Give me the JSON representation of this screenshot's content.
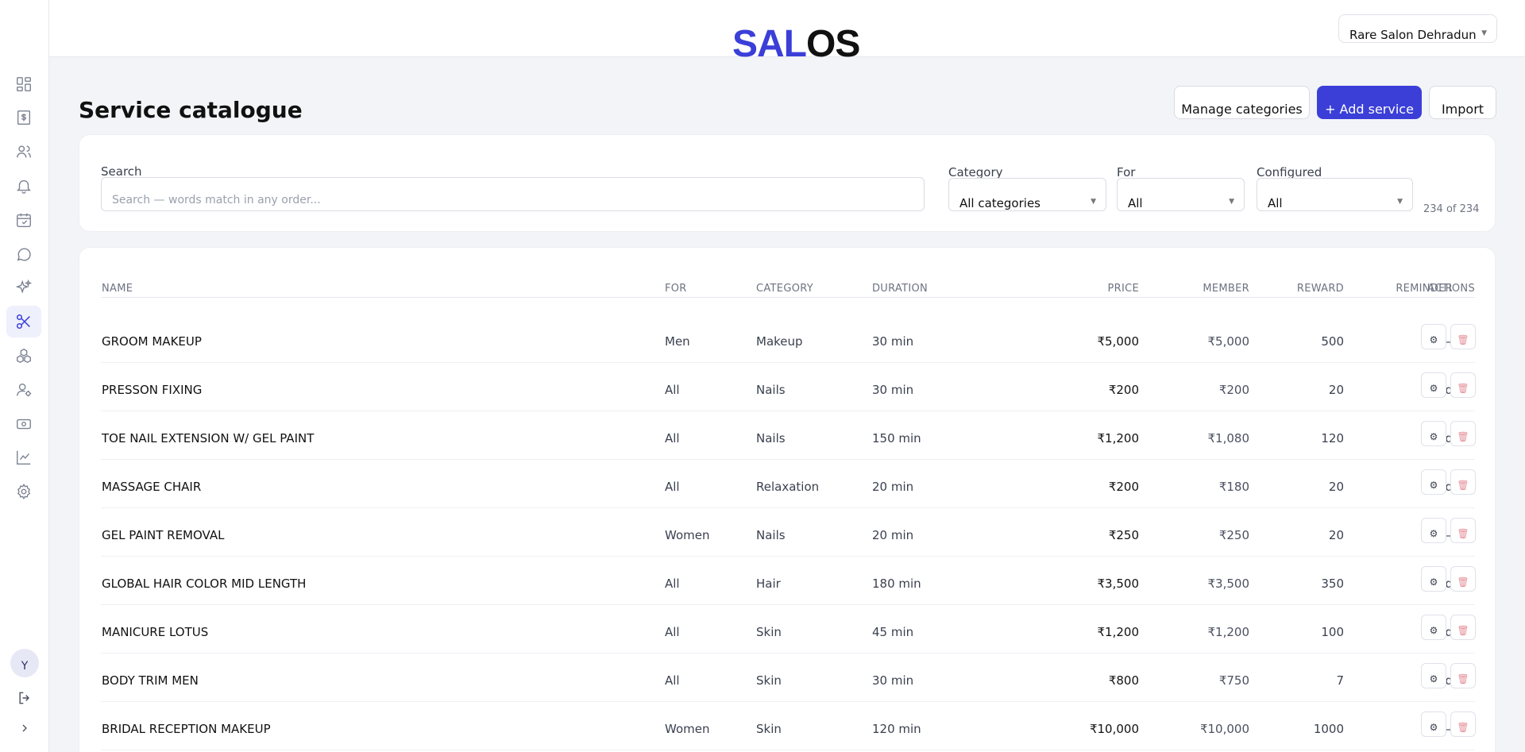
{
  "header": {
    "logo_part1": "SAL",
    "logo_part2": "OS",
    "salon_selected": "Rare Salon Dehradun"
  },
  "page": {
    "title": "Service catalogue",
    "buttons": {
      "manage_categories": "Manage categories",
      "add_service": "+ Add service",
      "import": "Import"
    }
  },
  "filters": {
    "search_label": "Search",
    "search_placeholder": "Search — words match in any order...",
    "category_label": "Category",
    "category_value": "All categories",
    "for_label": "For",
    "for_value": "All",
    "configured_label": "Configured",
    "configured_value": "All",
    "count": "234 of 234"
  },
  "table": {
    "columns": [
      "NAME",
      "FOR",
      "CATEGORY",
      "DURATION",
      "PRICE",
      "MEMBER",
      "REWARD",
      "REMINDER",
      "ACTIONS"
    ],
    "rows": [
      {
        "name": "GROOM MAKEUP",
        "for": "Men",
        "category": "Makeup",
        "duration": "30 min",
        "price": "₹5,000",
        "member": "₹5,000",
        "reward": "500",
        "reminder": "—"
      },
      {
        "name": "PRESSON FIXING",
        "for": "All",
        "category": "Nails",
        "duration": "30 min",
        "price": "₹200",
        "member": "₹200",
        "reward": "20",
        "reminder": "21d"
      },
      {
        "name": "TOE NAIL EXTENSION W/ GEL PAINT",
        "for": "All",
        "category": "Nails",
        "duration": "150 min",
        "price": "₹1,200",
        "member": "₹1,080",
        "reward": "120",
        "reminder": "21d"
      },
      {
        "name": "MASSAGE CHAIR",
        "for": "All",
        "category": "Relaxation",
        "duration": "20 min",
        "price": "₹200",
        "member": "₹180",
        "reward": "20",
        "reminder": "30d"
      },
      {
        "name": "GEL PAINT REMOVAL",
        "for": "Women",
        "category": "Nails",
        "duration": "20 min",
        "price": "₹250",
        "member": "₹250",
        "reward": "20",
        "reminder": "—"
      },
      {
        "name": "GLOBAL HAIR COLOR MID LENGTH",
        "for": "All",
        "category": "Hair",
        "duration": "180 min",
        "price": "₹3,500",
        "member": "₹3,500",
        "reward": "350",
        "reminder": "42d"
      },
      {
        "name": "MANICURE LOTUS",
        "for": "All",
        "category": "Skin",
        "duration": "45 min",
        "price": "₹1,200",
        "member": "₹1,200",
        "reward": "100",
        "reminder": "21d"
      },
      {
        "name": "BODY TRIM MEN",
        "for": "All",
        "category": "Skin",
        "duration": "30 min",
        "price": "₹800",
        "member": "₹750",
        "reward": "7",
        "reminder": "30d"
      },
      {
        "name": "BRIDAL RECEPTION MAKEUP",
        "for": "Women",
        "category": "Skin",
        "duration": "120 min",
        "price": "₹10,000",
        "member": "₹10,000",
        "reward": "1000",
        "reminder": "—"
      }
    ],
    "action_icons": {
      "edit": "⚙",
      "delete": "🗑"
    }
  },
  "sidebar": {
    "items": [
      "dashboard-icon",
      "billing-icon",
      "clients-icon",
      "notifications-icon",
      "appointments-icon",
      "chat-icon",
      "ai-sparkle-icon",
      "services-scissors-icon",
      "products-icon",
      "staff-icon",
      "payments-icon",
      "reports-icon",
      "settings-icon"
    ],
    "active": "services-scissors-icon",
    "avatar_initial": "Y"
  },
  "colors": {
    "accent": "#3b3fd8",
    "delete": "#e58f98"
  }
}
